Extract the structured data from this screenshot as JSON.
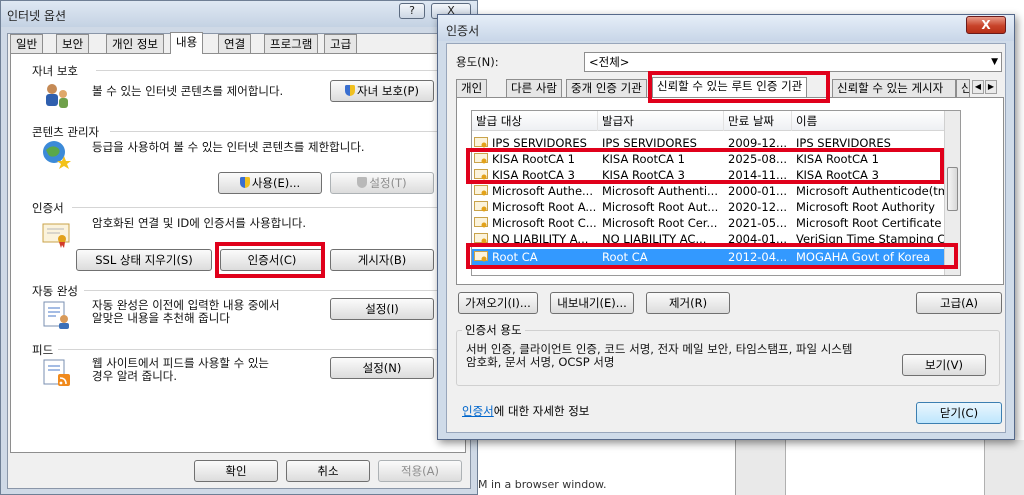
{
  "options_window": {
    "title": "인터넷 옵션",
    "help": "?",
    "close": "X",
    "tabs": [
      "일반",
      "보안",
      "개인 정보",
      "내용",
      "연결",
      "프로그램",
      "고급"
    ],
    "active_tab": 3,
    "parental": {
      "label": "자녀 보호",
      "desc": "볼 수 있는 인터넷 콘텐츠를 제어합니다.",
      "button": "자녀 보호(P)"
    },
    "content_advisor": {
      "label": "콘텐츠 관리자",
      "desc": "등급을 사용하여 볼 수 있는 인터넷 콘텐츠를 제한합니다.",
      "enable_button": "사용(E)...",
      "settings_button": "설정(T)"
    },
    "certificates": {
      "label": "인증서",
      "desc": "암호화된 연결 및 ID에 인증서를 사용합니다.",
      "ssl_button": "SSL 상태 지우기(S)",
      "cert_button": "인증서(C)",
      "publisher_button": "게시자(B)"
    },
    "autocomplete": {
      "label": "자동 완성",
      "desc_line1": "자동 완성은 이전에 입력한 내용 중에서",
      "desc_line2": "알맞은 내용을 추천해 줍니다",
      "button": "설정(I)"
    },
    "feeds": {
      "label": "피드",
      "desc_line1": "웹 사이트에서 피드를 사용할 수 있는",
      "desc_line2": "경우 알려 줍니다.",
      "button": "설정(N)"
    },
    "footer": {
      "ok": "확인",
      "cancel": "취소",
      "apply": "적용(A)"
    }
  },
  "cert_window": {
    "title": "인증서",
    "close": "X",
    "purpose_label": "용도(N):",
    "purpose_value": "<전체>",
    "tabs": [
      "개인",
      "다른 사람",
      "중개 인증 기관",
      "신뢰할 수 있는 루트 인증 기관",
      "신뢰할 수 있는 게시자",
      "신"
    ],
    "active_tab": 3,
    "columns": [
      "발급 대상",
      "발급자",
      "만료 날짜",
      "이름"
    ],
    "rows": [
      {
        "issued_to": "IPS SERVIDORES",
        "issuer": "IPS SERVIDORES",
        "expires": "2009-12...",
        "name": "IPS SERVIDORES",
        "selected": false
      },
      {
        "issued_to": "KISA RootCA 1",
        "issuer": "KISA RootCA 1",
        "expires": "2025-08...",
        "name": "KISA RootCA 1",
        "selected": false
      },
      {
        "issued_to": "KISA RootCA 3",
        "issuer": "KISA RootCA 3",
        "expires": "2014-11...",
        "name": "KISA RootCA 3",
        "selected": false
      },
      {
        "issued_to": "Microsoft Authe...",
        "issuer": "Microsoft Authenti...",
        "expires": "2000-01...",
        "name": "Microsoft Authenticode(tm...",
        "selected": false
      },
      {
        "issued_to": "Microsoft Root A...",
        "issuer": "Microsoft Root Aut...",
        "expires": "2020-12...",
        "name": "Microsoft Root Authority",
        "selected": false
      },
      {
        "issued_to": "Microsoft Root C...",
        "issuer": "Microsoft Root Cer...",
        "expires": "2021-05...",
        "name": "Microsoft Root Certificate ...",
        "selected": false
      },
      {
        "issued_to": "NO LIABILITY A...",
        "issuer": "NO LIABILITY AC...",
        "expires": "2004-01...",
        "name": "VeriSign Time Stamping CA",
        "selected": false
      },
      {
        "issued_to": "Root CA",
        "issuer": "Root CA",
        "expires": "2012-04...",
        "name": "MOGAHA Govt of Korea",
        "selected": true
      }
    ],
    "buttons": {
      "import": "가져오기(I)...",
      "export": "내보내기(E)...",
      "remove": "제거(R)",
      "advanced": "고급(A)"
    },
    "purpose_section": {
      "label": "인증서 용도",
      "text_line1": "서버 인증, 클라이언트 인증, 코드 서명, 전자 메일 보안, 타임스탬프, 파일 시스템",
      "text_line2": "암호화, 문서 서명, OCSP 서명",
      "view_button": "보기(V)"
    },
    "info_link": "인증서",
    "info_text": "에 대한 자세한 정보",
    "close_button": "닫기(C)"
  },
  "background": {
    "status_text": "M in a browser window."
  },
  "colors": {
    "highlight": "#e0001b",
    "selection": "#3399ff",
    "link": "#0066cc"
  }
}
